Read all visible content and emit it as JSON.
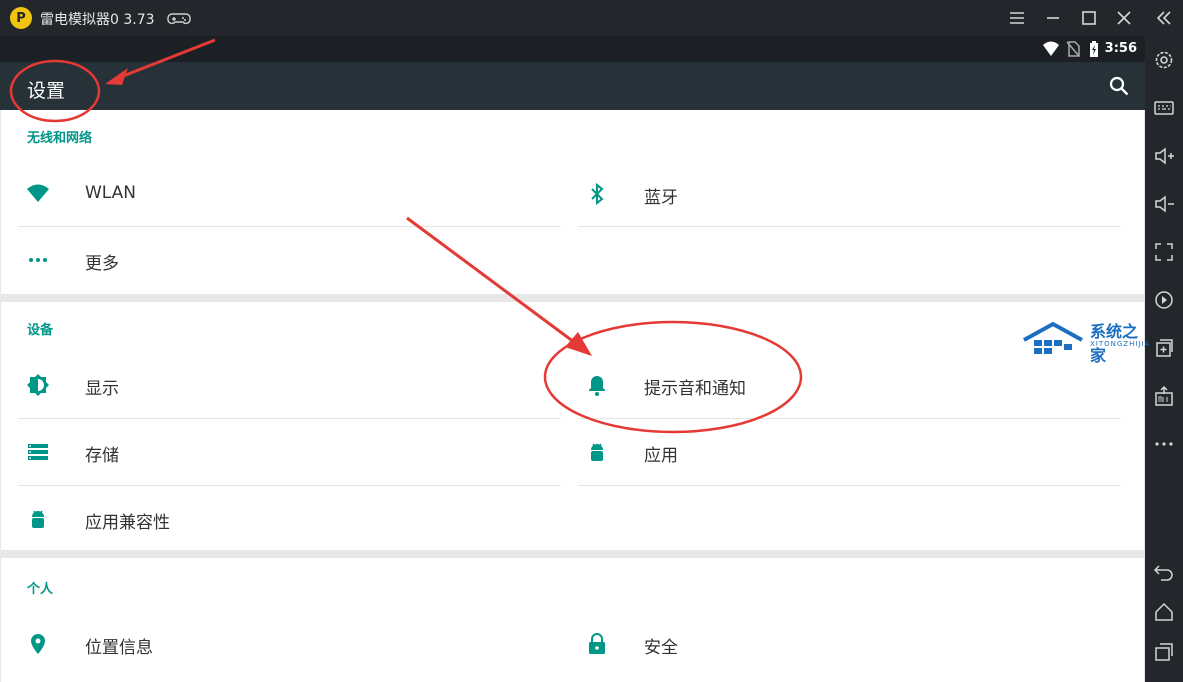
{
  "window": {
    "app_title": "雷电模拟器0 3.73",
    "logo_char": "P"
  },
  "status": {
    "time": "3:56"
  },
  "actionbar": {
    "title": "设置"
  },
  "sections": {
    "wireless": {
      "title": "无线和网络",
      "wlan": "WLAN",
      "bluetooth": "蓝牙",
      "more": "更多"
    },
    "device": {
      "title": "设备",
      "display": "显示",
      "sound": "提示音和通知",
      "storage": "存储",
      "apps": "应用",
      "compat": "应用兼容性"
    },
    "personal": {
      "title": "个人",
      "location": "位置信息",
      "security": "安全"
    }
  },
  "watermark": {
    "text": "系统之家",
    "sub": "XITONGZHIJIA"
  },
  "colors": {
    "accent": "#009688",
    "actionbar": "#263238",
    "annotation": "#e53935"
  }
}
